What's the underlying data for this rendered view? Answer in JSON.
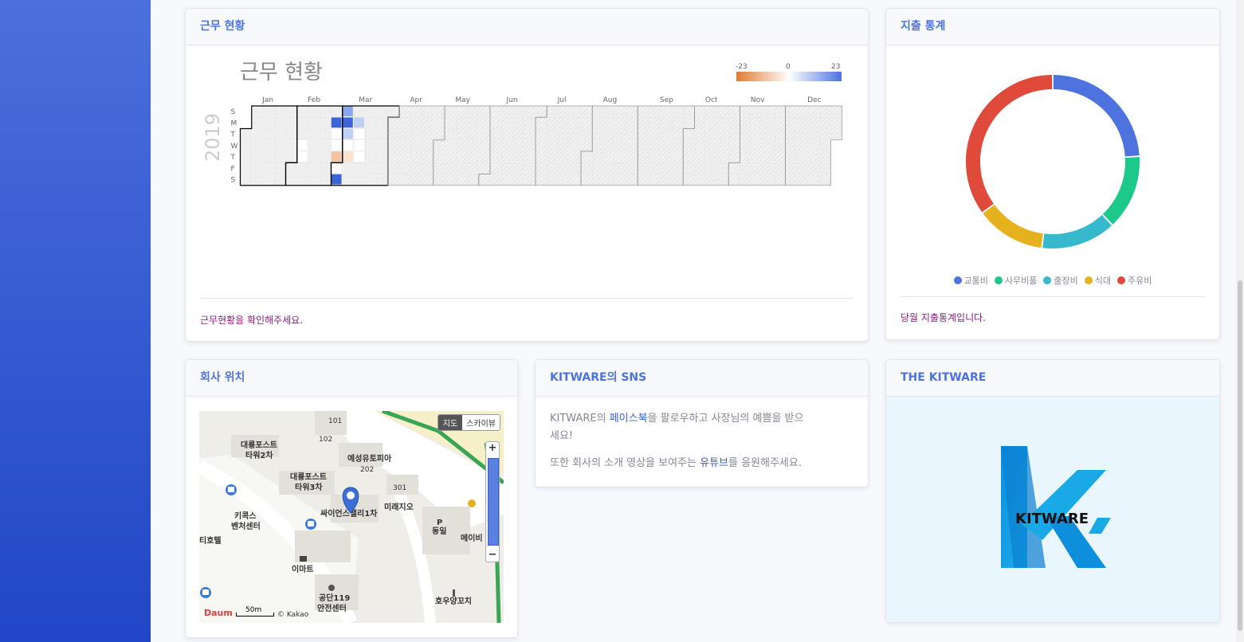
{
  "attendance": {
    "header": "근무 현황",
    "chart_title": "근무 현황",
    "year": "2019",
    "months": [
      "Jan",
      "Feb",
      "Mar",
      "Apr",
      "May",
      "Jun",
      "Jul",
      "Aug",
      "Sep",
      "Oct",
      "Nov",
      "Dec"
    ],
    "weekdays": [
      "S",
      "M",
      "T",
      "W",
      "T",
      "F",
      "S"
    ],
    "scale_min": "-23",
    "scale_mid": "0",
    "scale_max": "23",
    "note": "근무현황을 확인해주세요."
  },
  "expense": {
    "header": "지출 통계",
    "note": "당월 지출통계입니다.",
    "chart_data": {
      "type": "pie",
      "categories": [
        "교통비",
        "사무비품",
        "출장비",
        "식대",
        "주유비"
      ],
      "values": [
        24,
        14,
        14,
        13,
        35
      ],
      "colors": [
        "#4e73df",
        "#1cc88a",
        "#36b9cc",
        "#e6b11f",
        "#e04a3b"
      ]
    }
  },
  "location": {
    "header": "회사 위치",
    "map_type_map": "지도",
    "map_type_sky": "스카이뷰",
    "zoom_in": "+",
    "zoom_out": "−",
    "scale": "50m",
    "copyright": "© Kakao",
    "brand": "Daum",
    "labels": {
      "l101": "101",
      "l102": "102",
      "l202": "202",
      "l301": "301",
      "daeryong2a": "대륭포스트",
      "daeryong2b": "타워2차",
      "yeseong": "예성유토피아",
      "daeryong3a": "대륭포스트",
      "daeryong3b": "타워3차",
      "science": "싸이언스밸리1차",
      "mirae": "미래지오",
      "kikaxa": "키콕스",
      "kikaxb": "벤처센터",
      "hotel": "티호텔",
      "dongil": "동일",
      "meibi": "메이비",
      "emart": "이마트",
      "fire_a": "공단119",
      "fire_b": "안전센터",
      "hou": "호우양꼬치"
    }
  },
  "sns": {
    "header": "KITWARE의 SNS",
    "l1a": "KITWARE의 ",
    "l1link": "페이스북",
    "l1b": "을 팔로우하고 사장님의 예쁨을 받으",
    "l2": "세요!",
    "l3a": "또한 회사의 소개 영상을 보여주는 ",
    "l3link": "유튜브",
    "l3b": "를 응원해주세요."
  },
  "kitware": {
    "header": "THE KITWARE",
    "logo_text": "KITWARE"
  }
}
